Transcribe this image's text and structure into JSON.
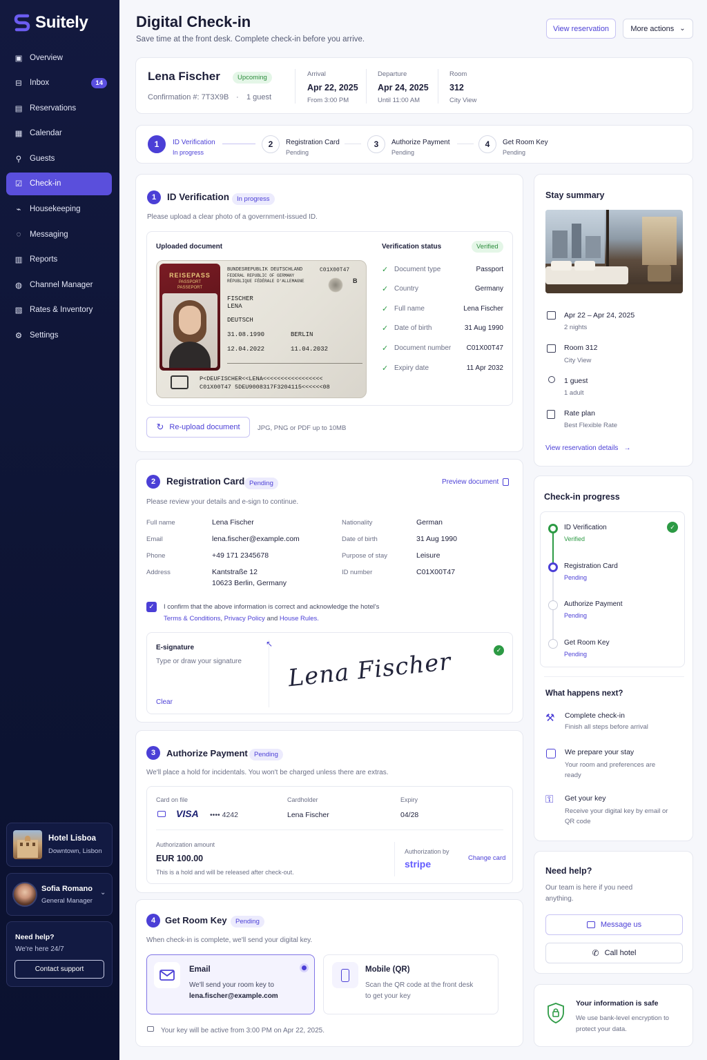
{
  "brand": {
    "name": "Suitely",
    "accent": "#4b3fd6",
    "sidebar_bg": "#0d1433",
    "success": "#2c9a44"
  },
  "sidebar": {
    "items": [
      {
        "label": "Overview",
        "icon": "chart-box-icon"
      },
      {
        "label": "Inbox",
        "icon": "inbox-icon",
        "badge": "14"
      },
      {
        "label": "Reservations",
        "icon": "calendar-list-icon"
      },
      {
        "label": "Calendar",
        "icon": "calendar-icon"
      },
      {
        "label": "Guests",
        "icon": "user-icon"
      },
      {
        "label": "Check-in",
        "icon": "clipboard-check-icon",
        "active": true
      },
      {
        "label": "Housekeeping",
        "icon": "broom-icon"
      },
      {
        "label": "Messaging",
        "icon": "chat-icon"
      },
      {
        "label": "Reports",
        "icon": "bar-chart-icon"
      },
      {
        "label": "Channel Manager",
        "icon": "globe-icon"
      },
      {
        "label": "Rates & Inventory",
        "icon": "rates-icon"
      },
      {
        "label": "Settings",
        "icon": "gear-icon"
      }
    ],
    "hotel": {
      "name": "Hotel Lisboa",
      "location": "Downtown, Lisbon"
    },
    "user": {
      "name": "Sofia Romano",
      "role": "General Manager"
    },
    "help": {
      "title": "Need help?",
      "subtitle": "We're here 24/7",
      "button": "Contact support"
    }
  },
  "header": {
    "title": "Digital Check-in",
    "subtitle": "Save time at the front desk. Complete check-in before you arrive.",
    "view_reservation": "View reservation",
    "more_actions": "More actions"
  },
  "guest": {
    "name": "Lena Fischer",
    "status": "Upcoming",
    "confirmation": "Confirmation #: 7T3X9B",
    "guests": "1 guest",
    "arrival_label": "Arrival",
    "arrival_date": "Apr 22, 2025",
    "arrival_time": "From 3:00 PM",
    "departure_label": "Departure",
    "departure_date": "Apr 24, 2025",
    "departure_time": "Until 11:00 AM",
    "room_label": "Room",
    "room_number": "312",
    "room_type": "City View"
  },
  "steps": [
    {
      "num": "1",
      "title": "ID Verification",
      "status": "In progress"
    },
    {
      "num": "2",
      "title": "Registration Card",
      "status": "Pending"
    },
    {
      "num": "3",
      "title": "Authorize Payment",
      "status": "Pending"
    },
    {
      "num": "4",
      "title": "Get Room Key",
      "status": "Pending"
    }
  ],
  "id_verification": {
    "num": "1",
    "title": "ID Verification",
    "status": "In progress",
    "desc": "Please upload a clear photo of a government-issued ID.",
    "uploaded_label": "Uploaded document",
    "verification_label": "Verification status",
    "verified": "Verified",
    "checks": [
      {
        "label": "Document type",
        "value": "Passport"
      },
      {
        "label": "Country",
        "value": "Germany"
      },
      {
        "label": "Full name",
        "value": "Lena Fischer"
      },
      {
        "label": "Date of birth",
        "value": "31 Aug 1990"
      },
      {
        "label": "Document number",
        "value": "C01X00T47"
      },
      {
        "label": "Expiry date",
        "value": "11 Apr 2032"
      }
    ],
    "reupload": "Re-upload document",
    "formats": "JPG, PNG or PDF up to 10MB",
    "passport": {
      "cover_title": "REISEPASS",
      "cover_sub1": "PASSPORT",
      "cover_sub2": "PASSEPORT",
      "country_line1": "BUNDESREPUBLIK DEUTSCHLAND",
      "country_line2": "FEDERAL REPUBLIC OF GERMANY",
      "country_line3": "RÉPUBLIQUE FÉDÉRALE D'ALLEMAGNE",
      "doc_no": "C01X00T47",
      "type": "B",
      "surname": "FISCHER",
      "given": "LENA",
      "nationality": "DEUTSCH",
      "dob": "31.08.1990",
      "place": "BERLIN",
      "issued": "12.04.2022",
      "expiry": "11.04.2032",
      "mrz1": "P<DEUFISCHER<<LENA<<<<<<<<<<<<<<<<<",
      "mrz2": "C01X00T47 5DEU9008317F3204115<<<<<<08"
    }
  },
  "registration": {
    "num": "2",
    "title": "Registration Card",
    "status": "Pending",
    "preview": "Preview document",
    "desc": "Please review your details and e-sign to continue.",
    "left": [
      {
        "label": "Full name",
        "value": "Lena Fischer"
      },
      {
        "label": "Email",
        "value": "lena.fischer@example.com"
      },
      {
        "label": "Phone",
        "value": "+49 171 2345678"
      },
      {
        "label": "Address",
        "value": "Kantstraße 12",
        "value2": "10623 Berlin, Germany"
      }
    ],
    "right": [
      {
        "label": "Nationality",
        "value": "German"
      },
      {
        "label": "Date of birth",
        "value": "31 Aug 1990"
      },
      {
        "label": "Purpose of stay",
        "value": "Leisure"
      },
      {
        "label": "ID number",
        "value": "C01X00T47"
      }
    ],
    "consent_text": "I confirm that the above information is correct and acknowledge the hotel's",
    "terms": "Terms & Conditions",
    "privacy": "Privacy Policy",
    "and": "and",
    "house_rules": "House Rules.",
    "esig_label": "E-signature",
    "esig_hint": "Type or draw your signature",
    "clear": "Clear",
    "signature": "Lena Fischer"
  },
  "payment": {
    "num": "3",
    "title": "Authorize Payment",
    "status": "Pending",
    "desc": "We'll place a hold for incidentals. You won't be charged unless there are extras.",
    "card_label": "Card on file",
    "card_brand": "VISA",
    "card_last4": "•••• 4242",
    "holder_label": "Cardholder",
    "holder": "Lena Fischer",
    "expiry_label": "Expiry",
    "expiry": "04/28",
    "amount_label": "Authorization amount",
    "amount": "EUR 100.00",
    "amount_note": "This is a hold and will be released after check-out.",
    "auth_by": "Authorization by",
    "processor": "stripe",
    "change_card": "Change card"
  },
  "room_key": {
    "num": "4",
    "title": "Get Room Key",
    "status": "Pending",
    "desc": "When check-in is complete, we'll send your digital key.",
    "email_title": "Email",
    "email_desc": "We'll send your room key to",
    "email_addr": "lena.fischer@example.com",
    "mobile_title": "Mobile (QR)",
    "mobile_desc1": "Scan the QR code at the front desk",
    "mobile_desc2": "to get your key",
    "active_note": "Your key will be active from 3:00 PM on Apr 22, 2025."
  },
  "stay_summary": {
    "title": "Stay summary",
    "dates": "Apr 22 – Apr 24, 2025",
    "nights": "2 nights",
    "room": "Room 312",
    "room_type": "City View",
    "guests": "1 guest",
    "adults": "1 adult",
    "rate_label": "Rate plan",
    "rate": "Best Flexible Rate",
    "details_link": "View reservation details"
  },
  "progress": {
    "title": "Check-in progress",
    "items": [
      {
        "title": "ID Verification",
        "status": "Verified"
      },
      {
        "title": "Registration Card",
        "status": "Pending"
      },
      {
        "title": "Authorize Payment",
        "status": "Pending"
      },
      {
        "title": "Get Room Key",
        "status": "Pending"
      }
    ],
    "next_title": "What happens next?",
    "next": [
      {
        "title": "Complete check-in",
        "desc": "Finish all steps before arrival"
      },
      {
        "title": "We prepare your stay",
        "desc": "Your room and preferences are ready"
      },
      {
        "title": "Get your key",
        "desc": "Receive your digital key by email or QR code"
      }
    ]
  },
  "need_help": {
    "title": "Need help?",
    "desc": "Our team is here if you need anything.",
    "message": "Message us",
    "call": "Call hotel"
  },
  "security": {
    "title": "Your information is safe",
    "desc": "We use bank-level encryption to protect your data."
  }
}
